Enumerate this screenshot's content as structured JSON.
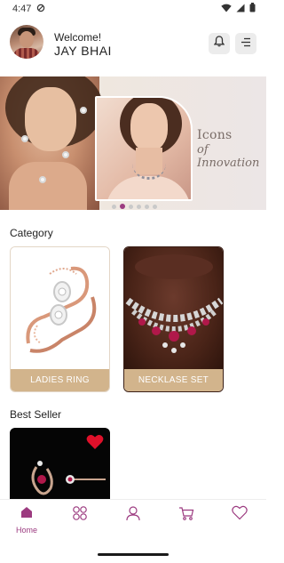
{
  "status_bar": {
    "time": "4:47"
  },
  "header": {
    "welcome": "Welcome!",
    "username": "JAY BHAI"
  },
  "banner": {
    "line1": "Icons",
    "line2": "of Innovation",
    "slide_count": 6,
    "active_slide": 2
  },
  "category": {
    "title": "Category",
    "items": [
      {
        "label": "LADIES RING"
      },
      {
        "label": "NECKLASE SET"
      }
    ]
  },
  "best_seller": {
    "title": "Best Seller",
    "favorite": true
  },
  "bottom_nav": {
    "items": [
      {
        "icon": "home-icon",
        "label": "Home",
        "active": true
      },
      {
        "icon": "category-grid-icon",
        "label": ""
      },
      {
        "icon": "profile-icon",
        "label": ""
      },
      {
        "icon": "cart-icon",
        "label": ""
      },
      {
        "icon": "heart-icon",
        "label": ""
      }
    ]
  },
  "colors": {
    "accent": "#9c3b80",
    "label_bg": "#d2b48c",
    "favorite": "#e0102a"
  }
}
